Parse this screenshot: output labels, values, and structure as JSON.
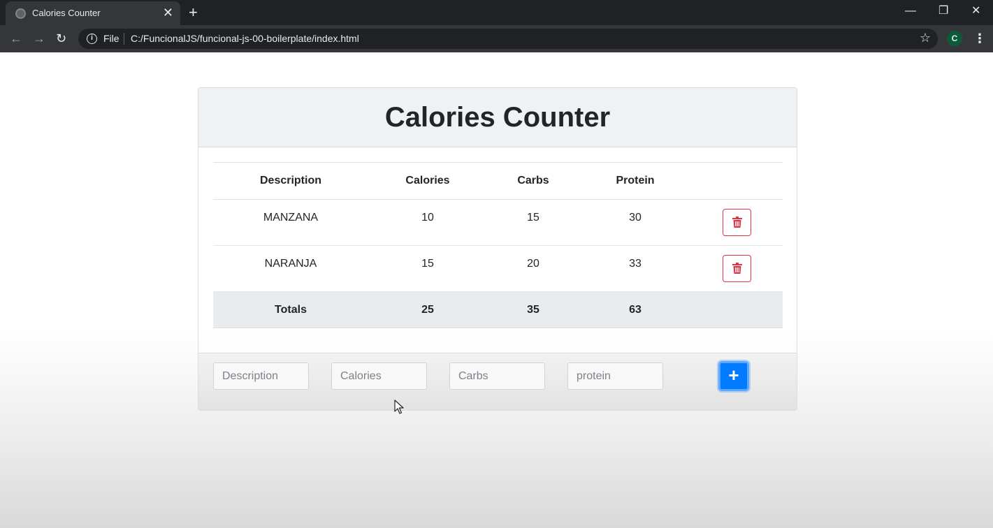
{
  "browser": {
    "tab_title": "Calories Counter",
    "tab_close": "✕",
    "new_tab": "+",
    "window_controls": {
      "minimize": "—",
      "restore": "❐",
      "close": "✕"
    },
    "nav": {
      "back": "←",
      "forward": "→",
      "reload": "↻"
    },
    "info_icon": "i",
    "scheme_label": "File",
    "url": "C:/FuncionalJS/funcional-js-00-boilerplate/index.html",
    "star": "☆",
    "profile_initial": "C",
    "menu": "⋮"
  },
  "app": {
    "title": "Calories Counter",
    "table": {
      "headers": [
        "Description",
        "Calories",
        "Carbs",
        "Protein"
      ],
      "rows": [
        {
          "description": "MANZANA",
          "calories": "10",
          "carbs": "15",
          "protein": "30"
        },
        {
          "description": "NARANJA",
          "calories": "15",
          "carbs": "20",
          "protein": "33"
        }
      ],
      "totals": {
        "label": "Totals",
        "calories": "25",
        "carbs": "35",
        "protein": "63"
      }
    },
    "form": {
      "description_placeholder": "Description",
      "calories_placeholder": "Calories",
      "carbs_placeholder": "Carbs",
      "protein_placeholder": "protein",
      "add_label": "+"
    },
    "colors": {
      "primary": "#007bff",
      "danger": "#dc3545",
      "text": "#212529"
    }
  }
}
